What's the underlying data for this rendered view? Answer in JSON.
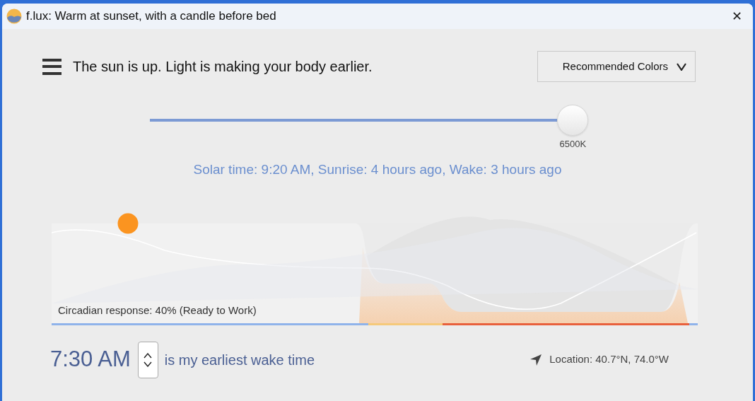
{
  "window": {
    "title": "f.lux: Warm at sunset, with a candle before bed",
    "close": "✕"
  },
  "status": "The sun is up. Light is making your body earlier.",
  "color_preset": {
    "label": "Recommended Colors"
  },
  "temperature": {
    "level": 0.965,
    "reading": "6500K"
  },
  "solar_info": "Solar time: 9:20 AM, Sunrise: 4 hours ago, Wake: 3 hours ago",
  "graph": {
    "caption": "Circadian response: 40% (Ready to Work)"
  },
  "wake": {
    "time": "7:30 AM",
    "label": "is my earliest wake time"
  },
  "location": "Location: 40.7°N, 74.0°W"
}
